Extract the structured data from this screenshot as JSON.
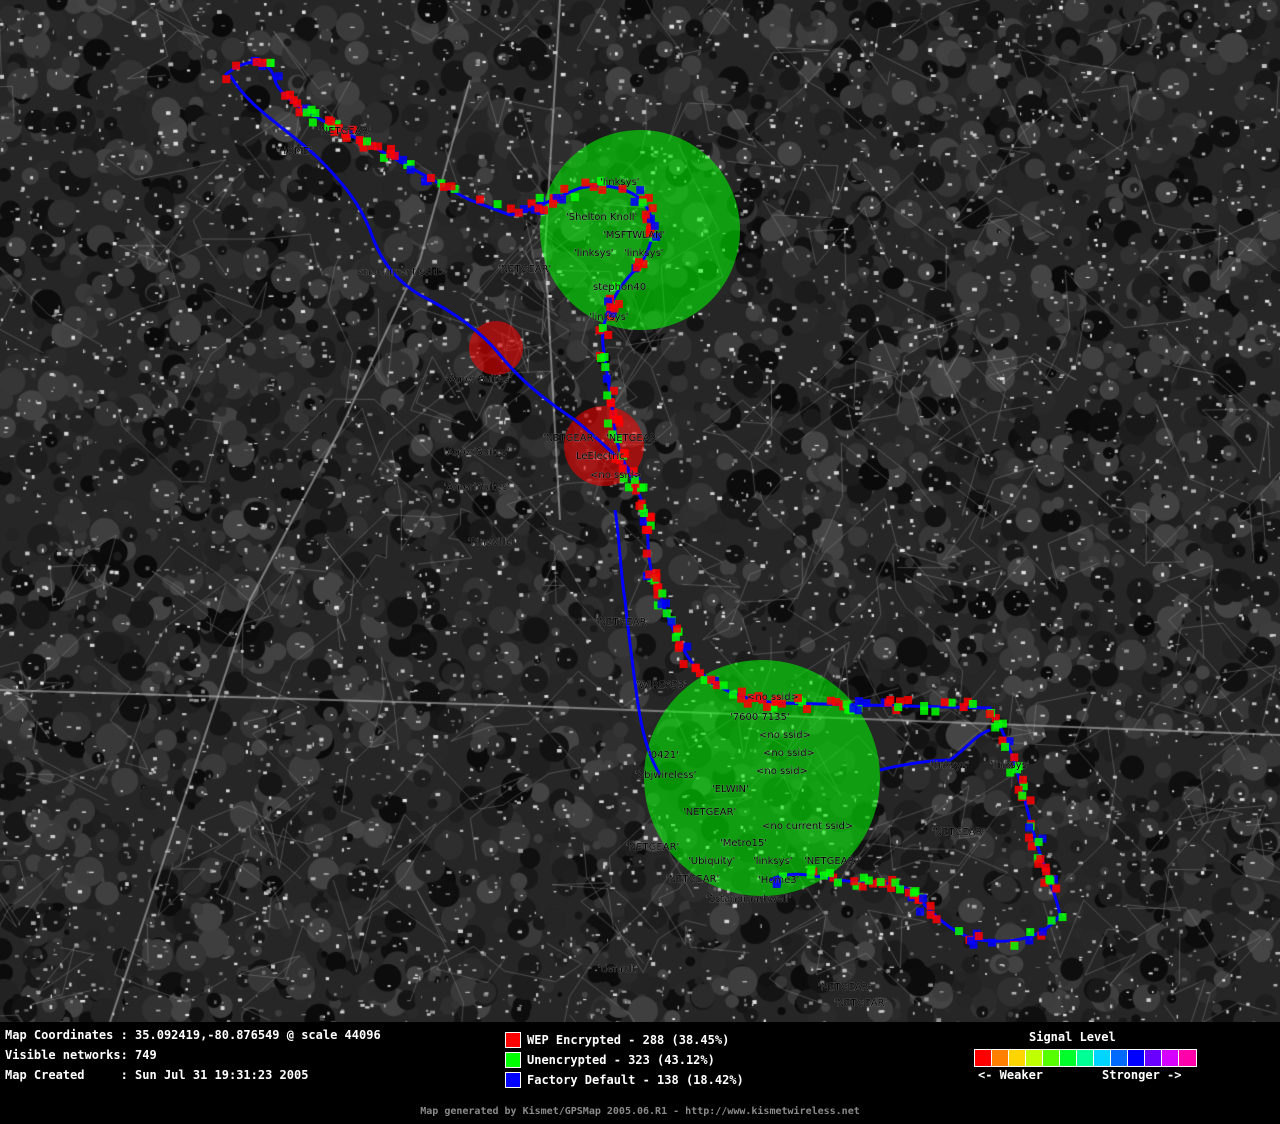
{
  "map": {
    "ssid_labels": [
      "'linksys'",
      "'Shelton Knoll'",
      "'MSFTWLAN'",
      "'linksys'",
      "'linksys'",
      "stephon40",
      "'linksys'",
      "'NETGEAR'",
      "'NETGEAR'",
      "'NETGEAR'",
      "LeElectric",
      "<no ssid>",
      "'NETGEAR'",
      "<no ssid>",
      "'7600 7135'",
      "<no ssid>",
      "<no ssid>",
      "<no ssid>",
      "'ELWIN'",
      "'NETGEAR'",
      "<no current ssid>",
      "'Metro15'",
      "'Ubiquity'",
      "'linksys'",
      "'NETGEAR'",
      "'Home3'",
      "'1standmarkwell'",
      "'linksys'",
      "'NETGEAR'",
      "'linksys'",
      "'NETGEAR'",
      "'NETGEAR'",
      "'bbjwireless'",
      "'0421'",
      "'WIRE653'",
      "'AmeriSuites'",
      "'AmeriSuites'",
      "'AmeriSuites'",
      "'Pineville'",
      "'NETGEAR'",
      "'default'",
      "'NETGEAR'",
      "<no current ssid>",
      "'HOME'",
      "'NETGEAR'"
    ]
  },
  "info": {
    "coordinates": "Map Coordinates : 35.092419,-80.876549 @ scale 44096",
    "visible_networks": "Visible networks: 749",
    "created": "Map Created     : Sun Jul 31 19:31:23 2005"
  },
  "legend": {
    "wep": {
      "label": "WEP Encrypted - 288 (38.45%)",
      "color": "#ff0000"
    },
    "unencrypted": {
      "label": "Unencrypted - 323 (43.12%)",
      "color": "#00ff00"
    },
    "factory": {
      "label": "Factory Default - 138 (18.42%)",
      "color": "#0000ff"
    }
  },
  "signal": {
    "title": "Signal Level",
    "weaker": "<- Weaker",
    "stronger": "Stronger ->",
    "colors": [
      "#ff0000",
      "#ff7f00",
      "#ffd500",
      "#bfff00",
      "#55ff00",
      "#00ff2a",
      "#00ff95",
      "#00d5ff",
      "#006aff",
      "#0000ff",
      "#6a00ff",
      "#d500ff",
      "#ff00aa"
    ]
  },
  "footer": "Map generated by Kismet/GPSMap 2005.06.R1 - http://www.kismetwireless.net"
}
